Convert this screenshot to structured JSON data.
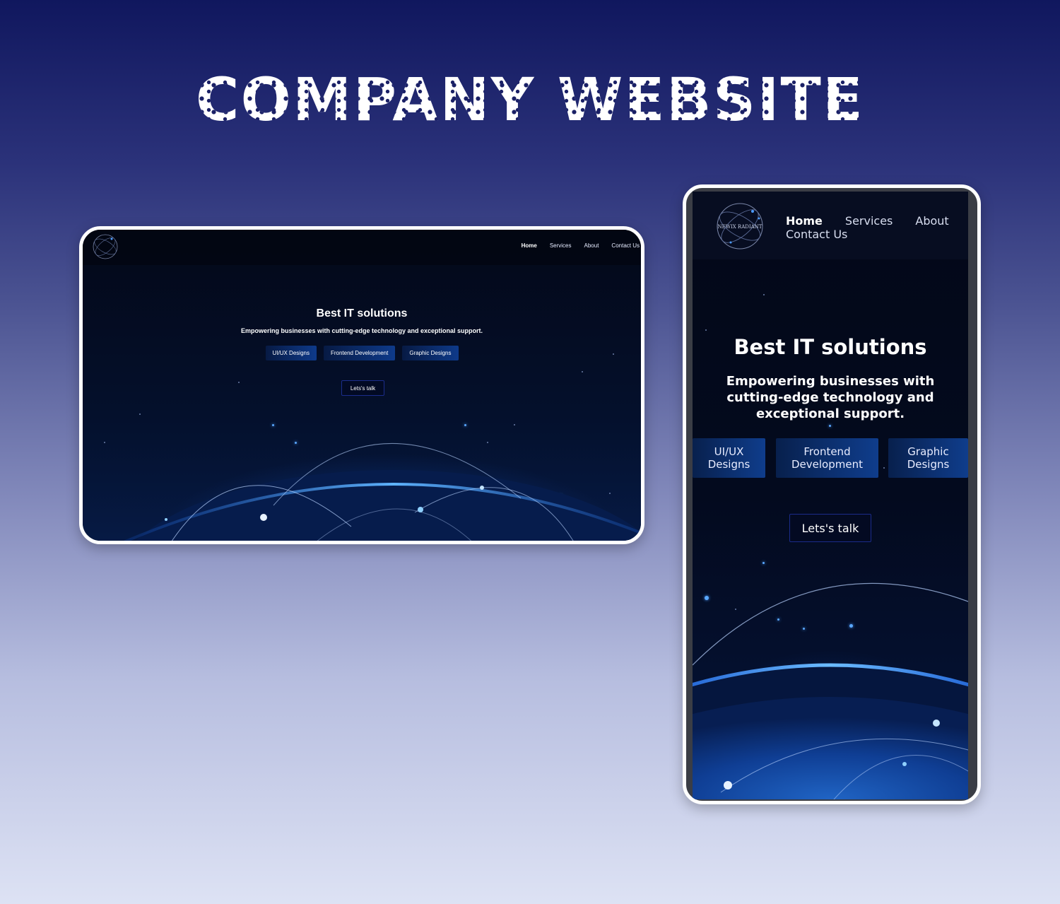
{
  "page_title": "COMPANY WEBSITE",
  "brand": {
    "logo_text": "NEWIX RADIANT",
    "colors": {
      "accent": "#0e3a8a",
      "glow": "#4c9bff",
      "background": "#030818"
    }
  },
  "desktop": {
    "nav": {
      "items": [
        "Home",
        "Services",
        "About",
        "Contact Us"
      ],
      "active": "Home"
    },
    "hero": {
      "title": "Best IT solutions",
      "subtitle": "Empowering businesses with cutting-edge technology and exceptional support.",
      "services": [
        "UI/UX Designs",
        "Frontend Development",
        "Graphic Designs"
      ],
      "cta": "Lets's talk"
    }
  },
  "mobile": {
    "nav": {
      "items": [
        "Home",
        "Services",
        "About",
        "Contact Us"
      ],
      "active": "Home"
    },
    "hero": {
      "title": "Best IT solutions",
      "subtitle": "Empowering businesses with cutting-edge technology and exceptional support.",
      "services": [
        "UI/UX Designs",
        "Frontend Development",
        "Graphic Designs"
      ],
      "cta": "Lets's talk"
    }
  }
}
